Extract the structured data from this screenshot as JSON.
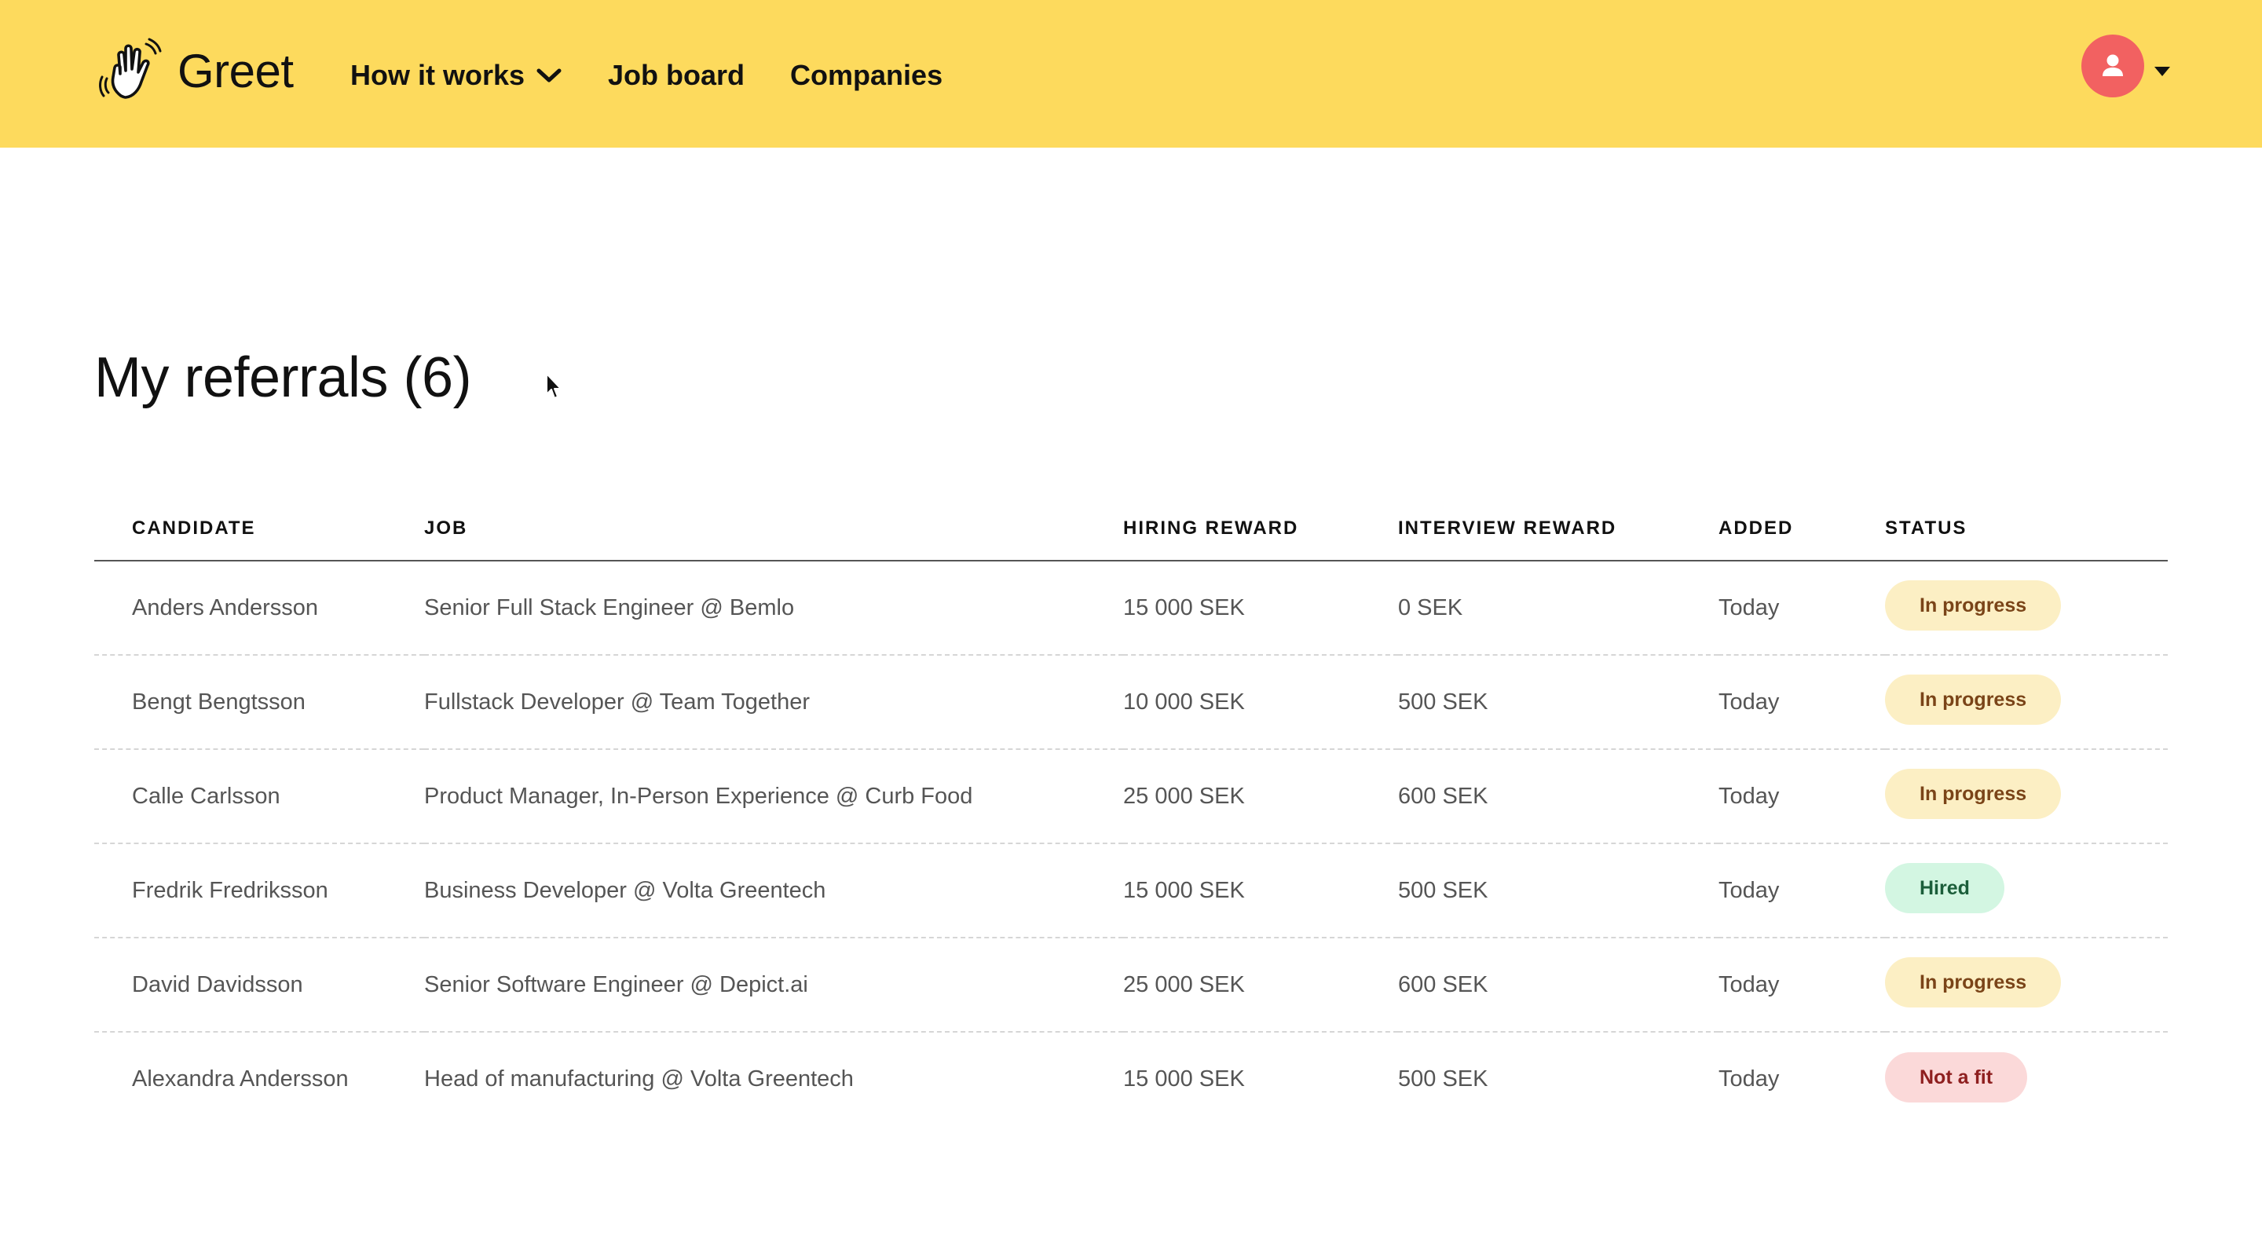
{
  "header": {
    "brand_name": "Greet",
    "brand_icon": "waving-hand-icon",
    "nav": [
      {
        "label": "How it works",
        "has_dropdown": true
      },
      {
        "label": "Job board"
      },
      {
        "label": "Companies"
      }
    ],
    "avatar_icon": "user-icon"
  },
  "page": {
    "title": "My referrals (6)"
  },
  "table": {
    "columns": [
      "CANDIDATE",
      "JOB",
      "HIRING REWARD",
      "INTERVIEW REWARD",
      "ADDED",
      "STATUS"
    ],
    "rows": [
      {
        "candidate": "Anders Andersson",
        "job": "Senior Full Stack Engineer @ Bemlo",
        "hiring_reward": "15 000 SEK",
        "interview_reward": "0 SEK",
        "added": "Today",
        "status": "In progress",
        "status_kind": "progress"
      },
      {
        "candidate": "Bengt Bengtsson",
        "job": "Fullstack Developer @ Team Together",
        "hiring_reward": "10 000 SEK",
        "interview_reward": "500 SEK",
        "added": "Today",
        "status": "In progress",
        "status_kind": "progress"
      },
      {
        "candidate": "Calle Carlsson",
        "job": "Product Manager, In-Person Experience @ Curb Food",
        "hiring_reward": "25 000 SEK",
        "interview_reward": "600 SEK",
        "added": "Today",
        "status": "In progress",
        "status_kind": "progress"
      },
      {
        "candidate": "Fredrik Fredriksson",
        "job": "Business Developer @ Volta Greentech",
        "hiring_reward": "15 000 SEK",
        "interview_reward": "500 SEK",
        "added": "Today",
        "status": "Hired",
        "status_kind": "hired"
      },
      {
        "candidate": "David Davidsson",
        "job": "Senior Software Engineer @ Depict.ai",
        "hiring_reward": "25 000 SEK",
        "interview_reward": "600 SEK",
        "added": "Today",
        "status": "In progress",
        "status_kind": "progress"
      },
      {
        "candidate": "Alexandra Andersson",
        "job": "Head of manufacturing @ Volta Greentech",
        "hiring_reward": "15 000 SEK",
        "interview_reward": "500 SEK",
        "added": "Today",
        "status": "Not a fit",
        "status_kind": "notfit"
      }
    ]
  },
  "colors": {
    "header_bg": "#FDDA5D",
    "avatar_bg": "#F26161",
    "badge_progress_bg": "#FCEFC4",
    "badge_hired_bg": "#D3F6E2",
    "badge_notfit_bg": "#FBD9D9"
  }
}
